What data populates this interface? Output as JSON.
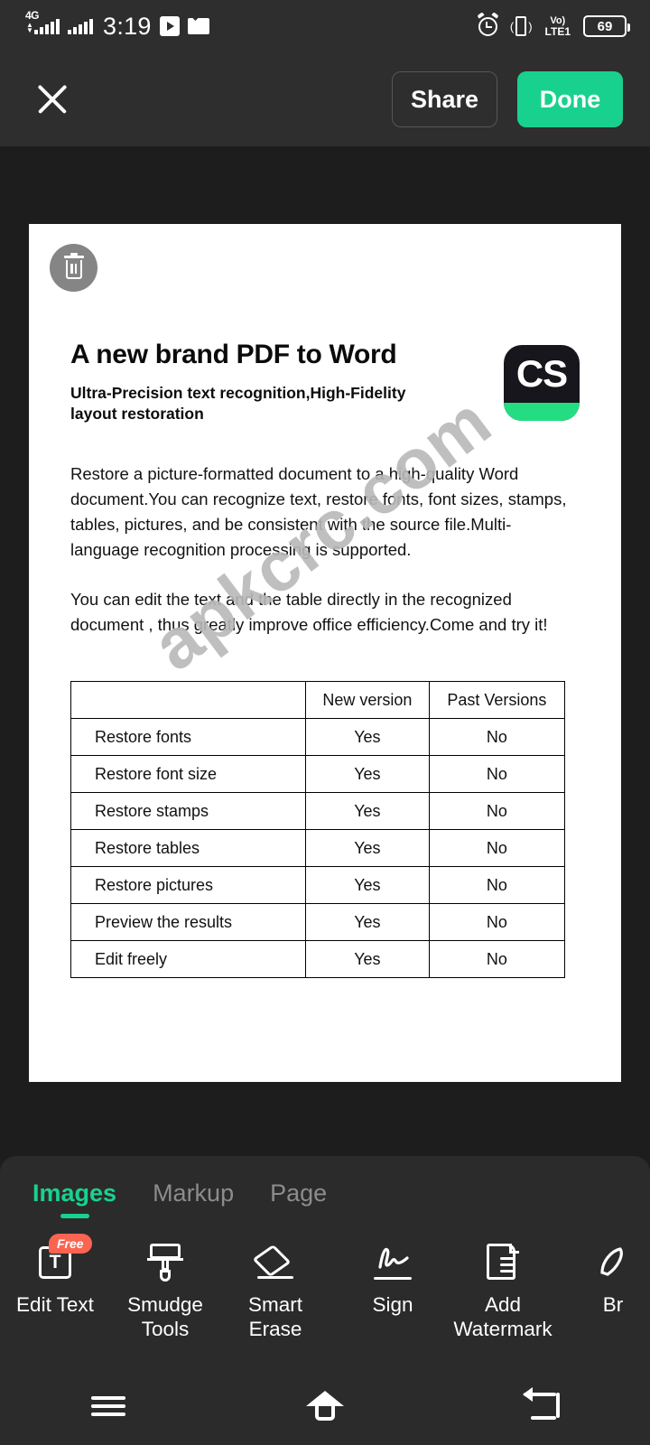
{
  "status_bar": {
    "network_label": "4G",
    "time": "3:19",
    "volte_line1": "Vo)",
    "volte_line2": "LTE1",
    "battery_percent": "69",
    "icons": [
      "signal-4g-icon",
      "signal-bars-icon",
      "play-store-icon",
      "mail-icon",
      "alarm-icon",
      "vibrate-icon",
      "volte-icon",
      "battery-icon"
    ]
  },
  "top_bar": {
    "close_label": "close-icon",
    "share_label": "Share",
    "done_label": "Done",
    "done_color": "#19d18f"
  },
  "document": {
    "delete_label": "trash-icon",
    "title": "A new brand PDF to Word",
    "subtitle": "Ultra-Precision text recognition,High-Fidelity layout restoration",
    "logo_text": "CS",
    "logo_bg": "#16161c",
    "logo_accent": "#24dd83",
    "paragraphs": [
      "Restore a picture-formatted document to a high-quality Word document.You can recognize text, restore fonts, font sizes, stamps, tables, pictures, and be consistent with the source file.Multi-language recognition processing is supported.",
      "You can edit the text and  the table directly in the recognized document , thus greatly improve office efficiency.Come and try it!"
    ],
    "watermark": "apkcrc.com",
    "table": {
      "headers": [
        "",
        "New version",
        "Past Versions"
      ],
      "rows": [
        [
          "Restore fonts",
          "Yes",
          "No"
        ],
        [
          "Restore font size",
          "Yes",
          "No"
        ],
        [
          "Restore stamps",
          "Yes",
          "No"
        ],
        [
          "Restore tables",
          "Yes",
          "No"
        ],
        [
          "Restore pictures",
          "Yes",
          "No"
        ],
        [
          "Preview the results",
          "Yes",
          "No"
        ],
        [
          "Edit freely",
          "Yes",
          "No"
        ]
      ]
    }
  },
  "bottom_panel": {
    "tabs": [
      {
        "label": "Images",
        "active": true
      },
      {
        "label": "Markup",
        "active": false
      },
      {
        "label": "Page",
        "active": false
      }
    ],
    "active_tab_color": "#19d18f",
    "tools": [
      {
        "label": "Edit Text",
        "icon": "edit-text-icon",
        "badge": "Free"
      },
      {
        "label": "Smudge Tools",
        "icon": "smudge-brush-icon",
        "badge": ""
      },
      {
        "label": "Smart Erase",
        "icon": "eraser-icon",
        "badge": ""
      },
      {
        "label": "Sign",
        "icon": "signature-icon",
        "badge": ""
      },
      {
        "label": "Add Watermark",
        "icon": "watermark-icon",
        "badge": ""
      },
      {
        "label": "Br",
        "icon": "brush-icon",
        "badge": ""
      }
    ]
  },
  "nav_bar": {
    "items": [
      {
        "name": "recents",
        "icon": "menu-icon"
      },
      {
        "name": "home",
        "icon": "home-icon"
      },
      {
        "name": "back",
        "icon": "back-arrow-icon"
      }
    ]
  }
}
